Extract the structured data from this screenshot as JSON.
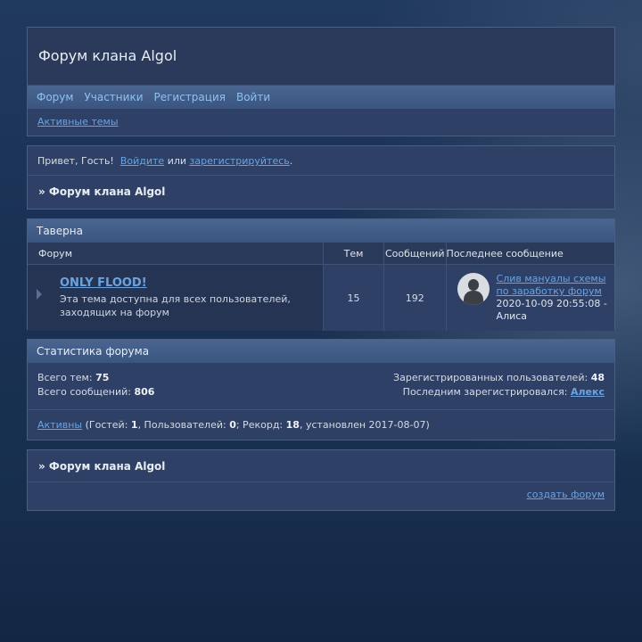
{
  "header": {
    "title": "Форум клана Algol",
    "nav": [
      "Форум",
      "Участники",
      "Регистрация",
      "Войти"
    ],
    "active_topics": "Активные темы"
  },
  "welcome": {
    "greeting": "Привет, Гость!",
    "login_link": "Войдите",
    "or": "или",
    "register_link": "зарегистрируйтесь",
    "period": ".",
    "breadcrumb": "» Форум клана Algol"
  },
  "category": {
    "title": "Таверна",
    "columns": [
      "Форум",
      "Тем",
      "Сообщений",
      "Последнее сообщение"
    ],
    "forums": [
      {
        "name": "ONLY FLOOD!",
        "description": "Эта тема доступна для всех пользователей, заходящих на форум",
        "topics": "15",
        "posts": "192",
        "last_topic": "Слив мануалы схемы по заработку форум",
        "last_date": "2020-10-09 20:55:08 -",
        "last_author": "Алиса"
      }
    ]
  },
  "stats": {
    "title": "Статистика форума",
    "total_topics_label": "Всего тем:",
    "total_topics": "75",
    "total_posts_label": "Всего сообщений:",
    "total_posts": "806",
    "registered_label": "Зарегистрированных пользователей:",
    "registered": "48",
    "last_registered_label": "Последним зарегистрировался:",
    "last_registered": "Алекс",
    "active_link": "Активны",
    "guests_label": "(Гостей:",
    "guests": "1",
    "users_label": ", Пользователей:",
    "users": "0",
    "record_label": "; Рекорд:",
    "record": "18",
    "record_set": ", установлен 2017-08-07)"
  },
  "footer": {
    "breadcrumb": "» Форум клана Algol",
    "create_forum": "создать форум"
  }
}
